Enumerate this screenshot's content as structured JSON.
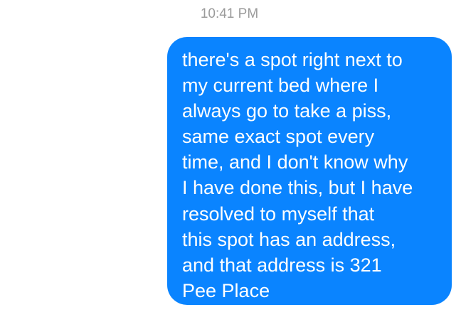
{
  "colors": {
    "accent": "#0a84ff",
    "timestamp": "#9b9b9b",
    "bubble_text": "#ffffff",
    "background": "#ffffff"
  },
  "thread": {
    "timestamp": "10:41 PM",
    "message": {
      "direction": "sent",
      "lines": [
        "there's a spot right next to",
        "my current bed where I",
        "always go to take a piss,",
        "same exact spot every",
        "time, and I don't know why",
        "I have done this, but I have",
        "resolved to myself that",
        "this spot has an address,",
        "and that address is 321",
        "Pee Place"
      ]
    }
  }
}
